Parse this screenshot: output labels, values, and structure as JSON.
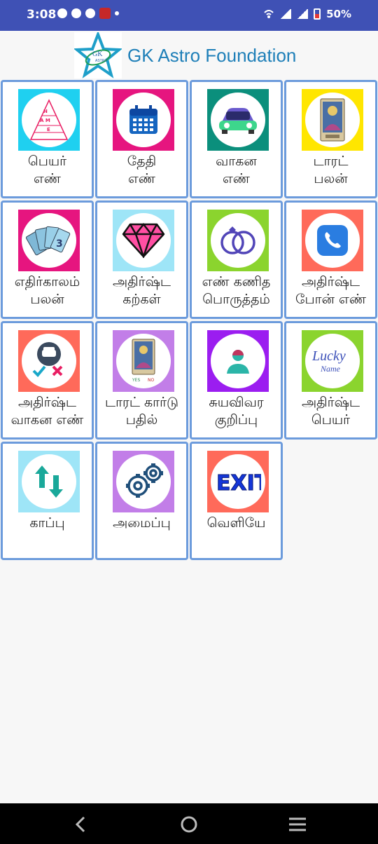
{
  "status": {
    "time": "3:08",
    "battery": "50%"
  },
  "header": {
    "title": "GK Astro Foundation",
    "logo_text": "GK ASTRO"
  },
  "menu": {
    "items": [
      {
        "line1": "பெயர்",
        "line2": "எண்",
        "icon": "name-pyramid-icon",
        "bg": "#1fd0f0",
        "icon_text": "N A M E"
      },
      {
        "line1": "தேதி",
        "line2": "எண்",
        "icon": "calendar-icon",
        "bg": "#e6157f"
      },
      {
        "line1": "வாகன",
        "line2": "எண்",
        "icon": "car-icon",
        "bg": "#0b8f7c"
      },
      {
        "line1": "டாரட்",
        "line2": "பலன்",
        "icon": "tarot-card-icon",
        "bg": "#ffe600"
      },
      {
        "line1": "எதிர்காலம்",
        "line2": "பலன்",
        "icon": "tarot-fan-icon",
        "bg": "#e6157f"
      },
      {
        "line1": "அதிர்ஷ்ட",
        "line2": "கற்கள்",
        "icon": "diamond-icon",
        "bg": "#9ee5f7"
      },
      {
        "line1": "எண் கணித",
        "line2": "பொருத்தம்",
        "icon": "rings-icon",
        "bg": "#8bd42e"
      },
      {
        "line1": "அதிர்ஷ்ட",
        "line2": "போன் எண்",
        "icon": "phone-icon",
        "bg": "#ff6a5a"
      },
      {
        "line1": "அதிர்ஷ்ட",
        "line2": "வாகன எண்",
        "icon": "car-check-icon",
        "bg": "#ff6a5a"
      },
      {
        "line1": "டாரட் கார்டு",
        "line2": "பதில்",
        "icon": "tarot-answer-icon",
        "bg": "#c27ee8",
        "icon_text": "YES   NO"
      },
      {
        "line1": "சுயவிவர",
        "line2": "குறிப்பு",
        "icon": "profile-icon",
        "bg": "#9b1df0"
      },
      {
        "line1": "அதிர்ஷ்ட",
        "line2": "பெயர்",
        "icon": "lucky-name-icon",
        "bg": "#8bd42e",
        "icon_text": "Lucky Name"
      },
      {
        "line1": "காப்பு",
        "line2": "",
        "icon": "backup-arrows-icon",
        "bg": "#9ee5f7"
      },
      {
        "line1": "அமைப்பு",
        "line2": "",
        "icon": "settings-gears-icon",
        "bg": "#c27ee8"
      },
      {
        "line1": "வெளியே",
        "line2": "",
        "icon": "exit-icon",
        "bg": "#ff6a5a",
        "icon_text": "EXIT"
      }
    ]
  },
  "nav": {
    "back": "back-icon",
    "home": "home-icon",
    "recents": "recents-icon"
  }
}
